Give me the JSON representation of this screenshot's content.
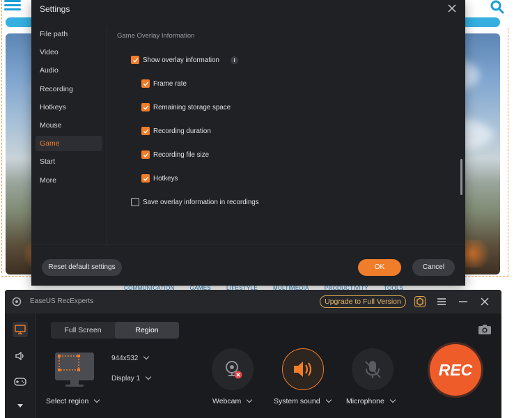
{
  "background": {
    "footer_links": [
      "COMMUNICATION",
      "GAMES",
      "LIFESTYLE",
      "MULTIMEDIA",
      "PRODUCTIVITY",
      "TOOLS"
    ]
  },
  "settings": {
    "title": "Settings",
    "nav": [
      "File path",
      "Video",
      "Audio",
      "Recording",
      "Hotkeys",
      "Mouse",
      "Game",
      "Start",
      "More"
    ],
    "active_nav": "Game",
    "section_title": "Game Overlay Information",
    "show_overlay": {
      "label": "Show overlay information",
      "checked": true
    },
    "sub_options": [
      {
        "label": "Frame rate",
        "checked": true
      },
      {
        "label": "Remaining storage space",
        "checked": true
      },
      {
        "label": "Recording duration",
        "checked": true
      },
      {
        "label": "Recording file size",
        "checked": true
      },
      {
        "label": "Hotkeys",
        "checked": true
      }
    ],
    "save_overlay": {
      "label": "Save overlay information in recordings",
      "checked": false
    },
    "reset_label": "Reset default settings",
    "ok_label": "OK",
    "cancel_label": "Cancel"
  },
  "recorder": {
    "app_name": "EaseUS RecExperts",
    "upgrade_label": "Upgrade to Full Version",
    "tabs": [
      "Full Screen",
      "Region"
    ],
    "active_tab": "Region",
    "resolution": "944x532",
    "display": "Display 1",
    "select_region_label": "Select region",
    "webcam_label": "Webcam",
    "system_sound_label": "System sound",
    "microphone_label": "Microphone",
    "rec_label": "REC",
    "accent_color": "#f07d2a",
    "rec_color": "#ee5c2a"
  }
}
